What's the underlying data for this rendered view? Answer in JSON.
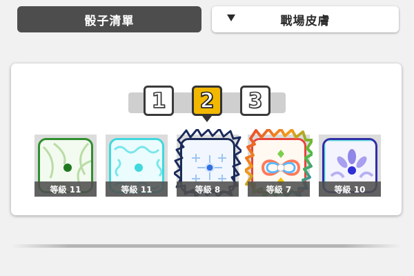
{
  "tabs": {
    "dice_list": "骰子清單",
    "battlefield_skin": "戰場皮膚"
  },
  "pager": {
    "pages": [
      "1",
      "2",
      "3"
    ],
    "active": "2"
  },
  "dice": [
    {
      "level": "等級 11",
      "icon": "green-vine-dice-icon",
      "color": "#2f8f2f"
    },
    {
      "level": "等級 11",
      "icon": "cyan-wave-dice-icon",
      "color": "#2cd1d8"
    },
    {
      "level": "等級 8",
      "icon": "ice-snowflake-dice-icon",
      "color": "#3b7be0"
    },
    {
      "level": "等級 7",
      "icon": "rainbow-infinity-dice-icon",
      "color": "#e8433a"
    },
    {
      "level": "等級 10",
      "icon": "purple-flower-dice-icon",
      "color": "#3a3ad8"
    }
  ]
}
